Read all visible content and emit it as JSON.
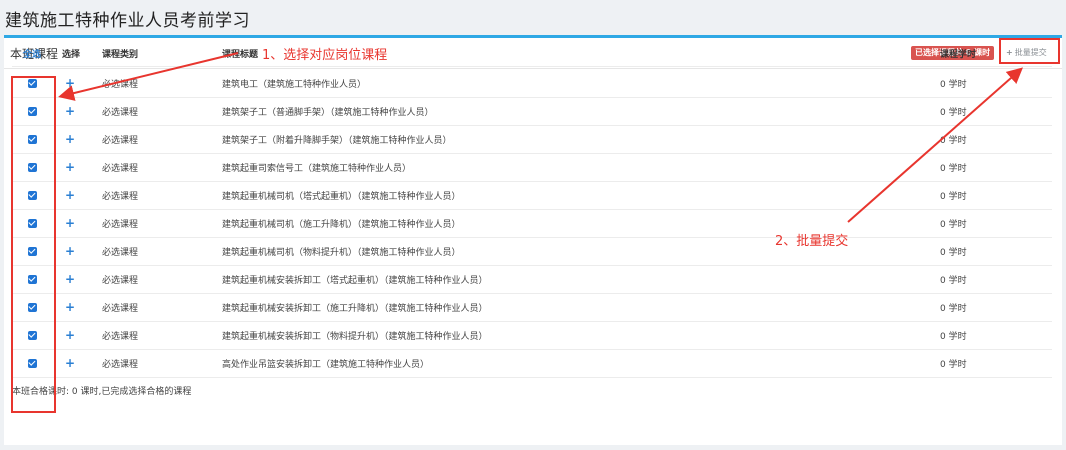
{
  "page": {
    "title": "建筑施工特种作业人员考前学习"
  },
  "panel": {
    "title": "本班课程",
    "selected_badge": "已选择课程共 0 课时",
    "batch_submit": "批量提交"
  },
  "table": {
    "headers": {
      "select_all": "全选",
      "select": "选择",
      "type": "课程类别",
      "title": "课程标题",
      "hours": "课程学时"
    },
    "rows": [
      {
        "checked": true,
        "type": "必选课程",
        "title": "建筑电工（建筑施工特种作业人员）",
        "hours": "0 学时"
      },
      {
        "checked": true,
        "type": "必选课程",
        "title": "建筑架子工（普通脚手架）（建筑施工特种作业人员）",
        "hours": "0 学时"
      },
      {
        "checked": true,
        "type": "必选课程",
        "title": "建筑架子工（附着升降脚手架）（建筑施工特种作业人员）",
        "hours": "0 学时"
      },
      {
        "checked": true,
        "type": "必选课程",
        "title": "建筑起重司索信号工（建筑施工特种作业人员）",
        "hours": "0 学时"
      },
      {
        "checked": true,
        "type": "必选课程",
        "title": "建筑起重机械司机（塔式起重机）（建筑施工特种作业人员）",
        "hours": "0 学时"
      },
      {
        "checked": true,
        "type": "必选课程",
        "title": "建筑起重机械司机（施工升降机）（建筑施工特种作业人员）",
        "hours": "0 学时"
      },
      {
        "checked": true,
        "type": "必选课程",
        "title": "建筑起重机械司机（物料提升机）（建筑施工特种作业人员）",
        "hours": "0 学时"
      },
      {
        "checked": true,
        "type": "必选课程",
        "title": "建筑起重机械安装拆卸工（塔式起重机）（建筑施工特种作业人员）",
        "hours": "0 学时"
      },
      {
        "checked": true,
        "type": "必选课程",
        "title": "建筑起重机械安装拆卸工（施工升降机）（建筑施工特种作业人员）",
        "hours": "0 学时"
      },
      {
        "checked": true,
        "type": "必选课程",
        "title": "建筑起重机械安装拆卸工（物料提升机）（建筑施工特种作业人员）",
        "hours": "0 学时"
      },
      {
        "checked": true,
        "type": "必选课程",
        "title": "高处作业吊篮安装拆卸工（建筑施工特种作业人员）",
        "hours": "0 学时"
      }
    ]
  },
  "footer": {
    "note": "本班合格课时: 0 课时,已完成选择合格的课程"
  },
  "annotations": {
    "step1": "1、选择对应岗位课程",
    "step2": "2、批量提交"
  },
  "icons": {
    "plus": "+",
    "checkbox": "checkmark-icon"
  },
  "colors": {
    "accent": "#2ea8e5",
    "link": "#2a7fd3",
    "badge": "#d9534f",
    "annotation": "#e8352e"
  }
}
